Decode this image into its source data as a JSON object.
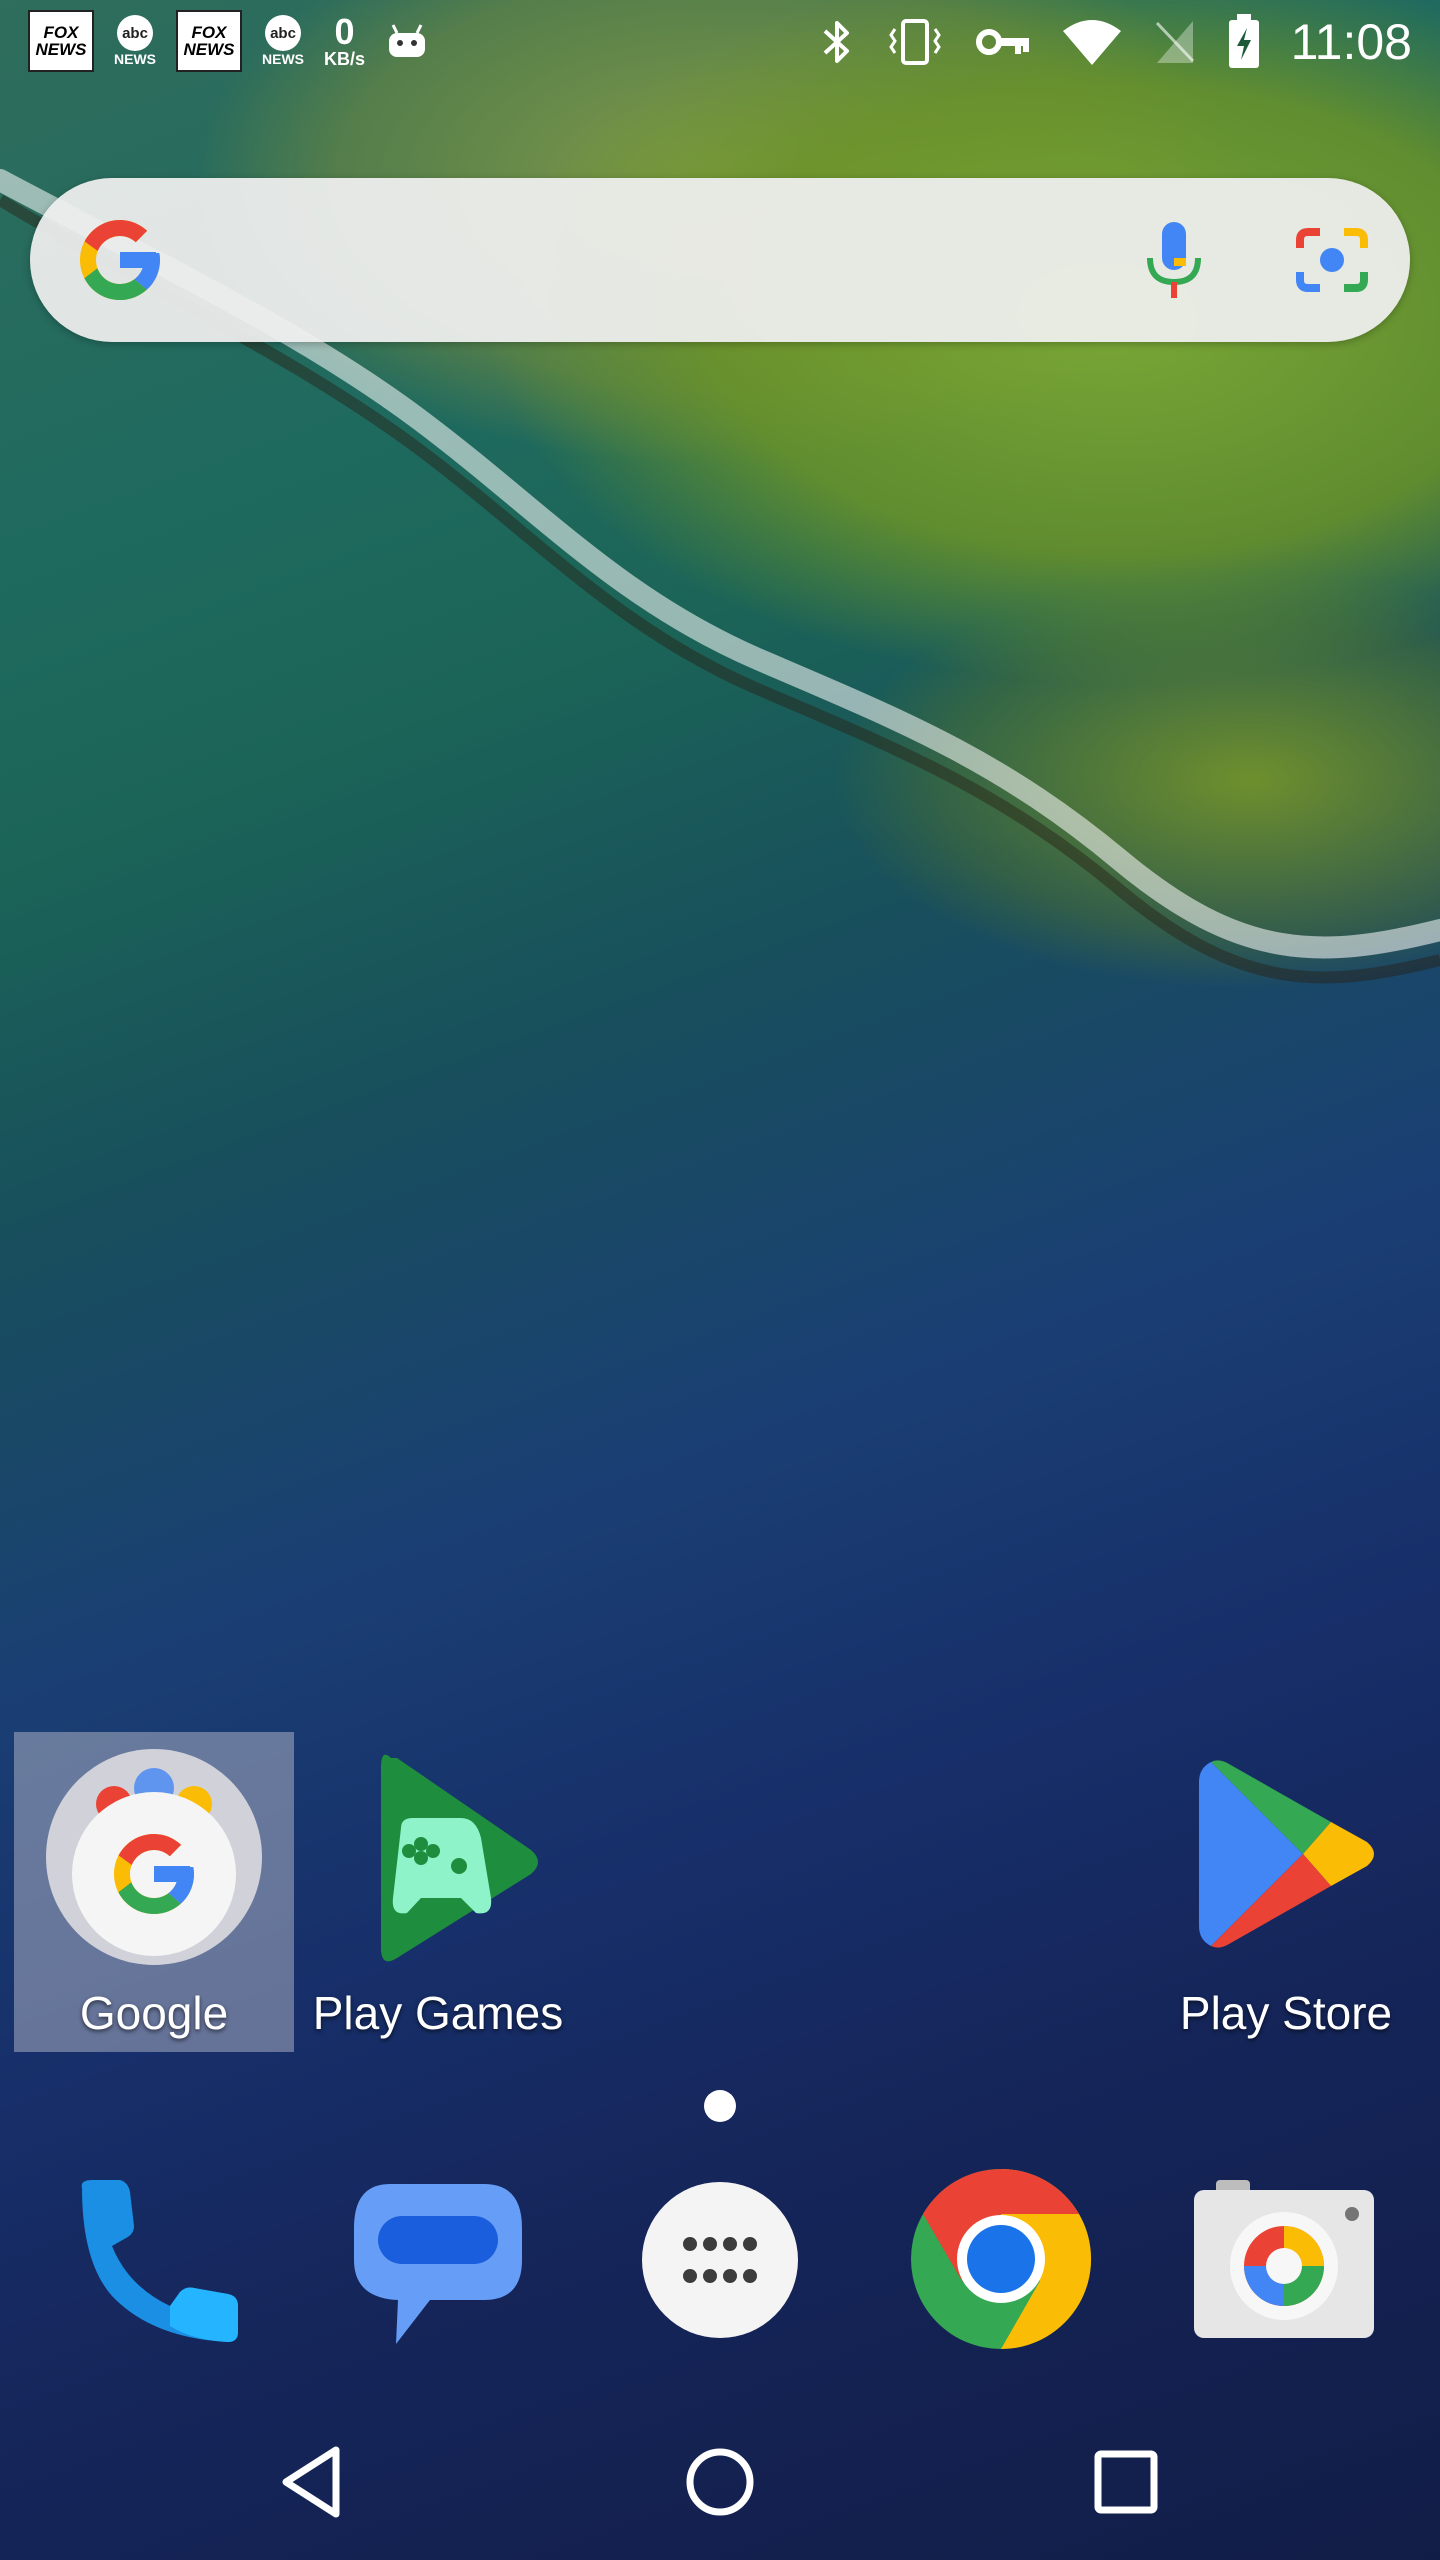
{
  "status_bar": {
    "left_icons": [
      {
        "name": "fox-news-icon",
        "text": "FOX NEWS"
      },
      {
        "name": "abc-news-icon",
        "text": "abc",
        "caption": "NEWS"
      },
      {
        "name": "fox-news-icon",
        "text": "FOX NEWS"
      },
      {
        "name": "abc-news-icon",
        "text": "abc",
        "caption": "NEWS"
      }
    ],
    "net_speed_value": "0",
    "net_speed_unit": "KB/s",
    "right_icons": [
      "bluetooth-icon",
      "vibrate-icon",
      "vpn-key-icon",
      "wifi-icon",
      "no-signal-icon",
      "battery-charging-icon"
    ],
    "time": "11:08"
  },
  "search_bar": {
    "icons": [
      "google-g-icon",
      "microphone-icon",
      "google-lens-icon"
    ]
  },
  "home_apps": [
    {
      "label": "Google",
      "icon": "google-folder-icon",
      "selected": true
    },
    {
      "label": "Play Games",
      "icon": "play-games-icon",
      "selected": false
    },
    {
      "label": "Play Store",
      "icon": "play-store-icon",
      "selected": false
    }
  ],
  "page_indicator": {
    "pages": 1,
    "current": 1
  },
  "dock": [
    "phone-icon",
    "messages-icon",
    "app-drawer-icon",
    "chrome-icon",
    "camera-icon"
  ],
  "nav_bar": [
    "back-button",
    "home-button",
    "recents-button"
  ],
  "colors": {
    "google_blue": "#4285F4",
    "google_red": "#EA4335",
    "google_yellow": "#FBBC05",
    "google_green": "#34A853"
  }
}
